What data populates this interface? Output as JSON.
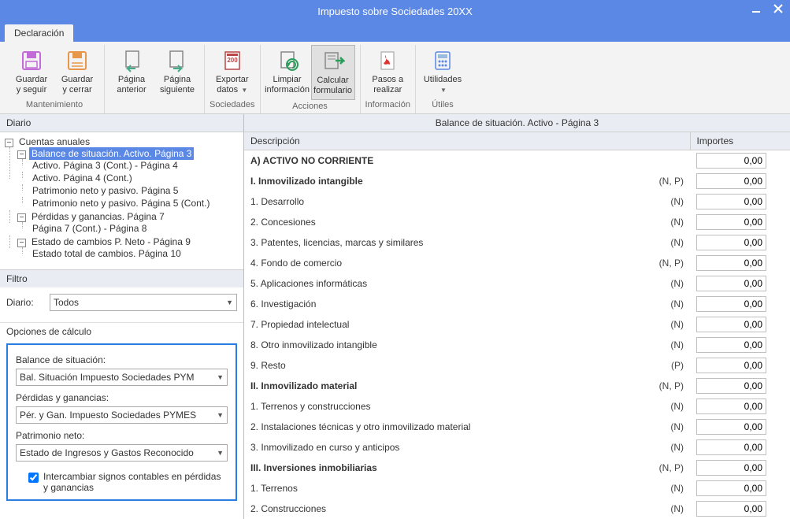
{
  "window": {
    "title": "Impuesto sobre Sociedades 20XX"
  },
  "tab": {
    "label": "Declaración"
  },
  "ribbon": {
    "groups": [
      {
        "title": "Mantenimiento",
        "buttons": [
          {
            "label1": "Guardar",
            "label2": "y seguir",
            "icon": "save",
            "color": "#c36bd7"
          },
          {
            "label1": "Guardar",
            "label2": "y cerrar",
            "icon": "save-close",
            "color": "#e8964a"
          }
        ]
      },
      {
        "title": "",
        "buttons": [
          {
            "label1": "Página",
            "label2": "anterior",
            "icon": "page-prev"
          },
          {
            "label1": "Página",
            "label2": "siguiente",
            "icon": "page-next"
          }
        ]
      },
      {
        "title": "Sociedades",
        "buttons": [
          {
            "label1": "Exportar",
            "label2": "datos",
            "icon": "export",
            "dropdown": true
          }
        ]
      },
      {
        "title": "Acciones",
        "buttons": [
          {
            "label1": "Limpiar",
            "label2": "información",
            "icon": "clean"
          },
          {
            "label1": "Calcular",
            "label2": "formulario",
            "icon": "calc",
            "active": true
          }
        ]
      },
      {
        "title": "Información",
        "buttons": [
          {
            "label1": "Pasos a",
            "label2": "realizar",
            "icon": "pdf"
          }
        ]
      },
      {
        "title": "Útiles",
        "buttons": [
          {
            "label1": "Utilidades",
            "label2": "",
            "icon": "util",
            "dropdown": true
          }
        ]
      }
    ]
  },
  "left": {
    "diario_title": "Diario",
    "tree": {
      "root": "Cuentas anuales",
      "selected": "Balance de situación. Activo. Página 3",
      "children_a": [
        "Activo. Página 3 (Cont.) - Página 4",
        "Activo. Página 4 (Cont.)",
        "Patrimonio neto y pasivo. Página 5",
        "Patrimonio neto y pasivo. Página 5 (Cont.)"
      ],
      "node_b": "Pérdidas y ganancias. Página 7",
      "children_b": [
        "Página 7 (Cont.) - Página 8"
      ],
      "node_c": "Estado de cambios P. Neto - Página 9",
      "children_c": [
        "Estado total de cambios. Página 10"
      ]
    },
    "filter": {
      "title": "Filtro",
      "diario_label": "Diario:",
      "diario_value": "Todos"
    },
    "options": {
      "title": "Opciones de cálculo",
      "balance_label": "Balance de situación:",
      "balance_value": "Bal. Situación  Impuesto Sociedades PYM",
      "pyg_label": "Pérdidas y ganancias:",
      "pyg_value": "Pér. y Gan.  Impuesto Sociedades PYMES",
      "patrimonio_label": "Patrimonio neto:",
      "patrimonio_value": "Estado de Ingresos y Gastos Reconocido",
      "check_label": "Intercambiar signos contables en pérdidas y ganancias"
    }
  },
  "right": {
    "title": "Balance de situación. Activo - Página 3",
    "headers": {
      "desc": "Descripción",
      "importes": "Importes"
    },
    "rows": [
      {
        "desc": "A) ACTIVO NO CORRIENTE",
        "bold": true,
        "tag": "",
        "val": "0,00"
      },
      {
        "desc": "I. Inmovilizado intangible",
        "bold": true,
        "tag": "(N, P)",
        "val": "0,00"
      },
      {
        "desc": "1. Desarrollo",
        "tag": "(N)",
        "val": "0,00"
      },
      {
        "desc": "2. Concesiones",
        "tag": "(N)",
        "val": "0,00"
      },
      {
        "desc": "3. Patentes, licencias, marcas y similares",
        "tag": "(N)",
        "val": "0,00"
      },
      {
        "desc": "4. Fondo de comercio",
        "tag": "(N, P)",
        "val": "0,00"
      },
      {
        "desc": "5. Aplicaciones informáticas",
        "tag": "(N)",
        "val": "0,00"
      },
      {
        "desc": "6. Investigación",
        "tag": "(N)",
        "val": "0,00"
      },
      {
        "desc": "7. Propiedad intelectual",
        "tag": "(N)",
        "val": "0,00"
      },
      {
        "desc": "8. Otro inmovilizado intangible",
        "tag": "(N)",
        "val": "0,00"
      },
      {
        "desc": "9. Resto",
        "tag": "(P)",
        "val": "0,00"
      },
      {
        "desc": "II. Inmovilizado material",
        "bold": true,
        "tag": "(N, P)",
        "val": "0,00"
      },
      {
        "desc": "1. Terrenos y construcciones",
        "tag": "(N)",
        "val": "0,00"
      },
      {
        "desc": "2. Instalaciones técnicas y otro inmovilizado material",
        "tag": "(N)",
        "val": "0,00"
      },
      {
        "desc": "3. Inmovilizado en curso y anticipos",
        "tag": "(N)",
        "val": "0,00"
      },
      {
        "desc": "III. Inversiones inmobiliarias",
        "bold": true,
        "tag": "(N, P)",
        "val": "0,00"
      },
      {
        "desc": "1. Terrenos",
        "tag": "(N)",
        "val": "0,00"
      },
      {
        "desc": "2. Construcciones",
        "tag": "(N)",
        "val": "0,00"
      }
    ]
  }
}
